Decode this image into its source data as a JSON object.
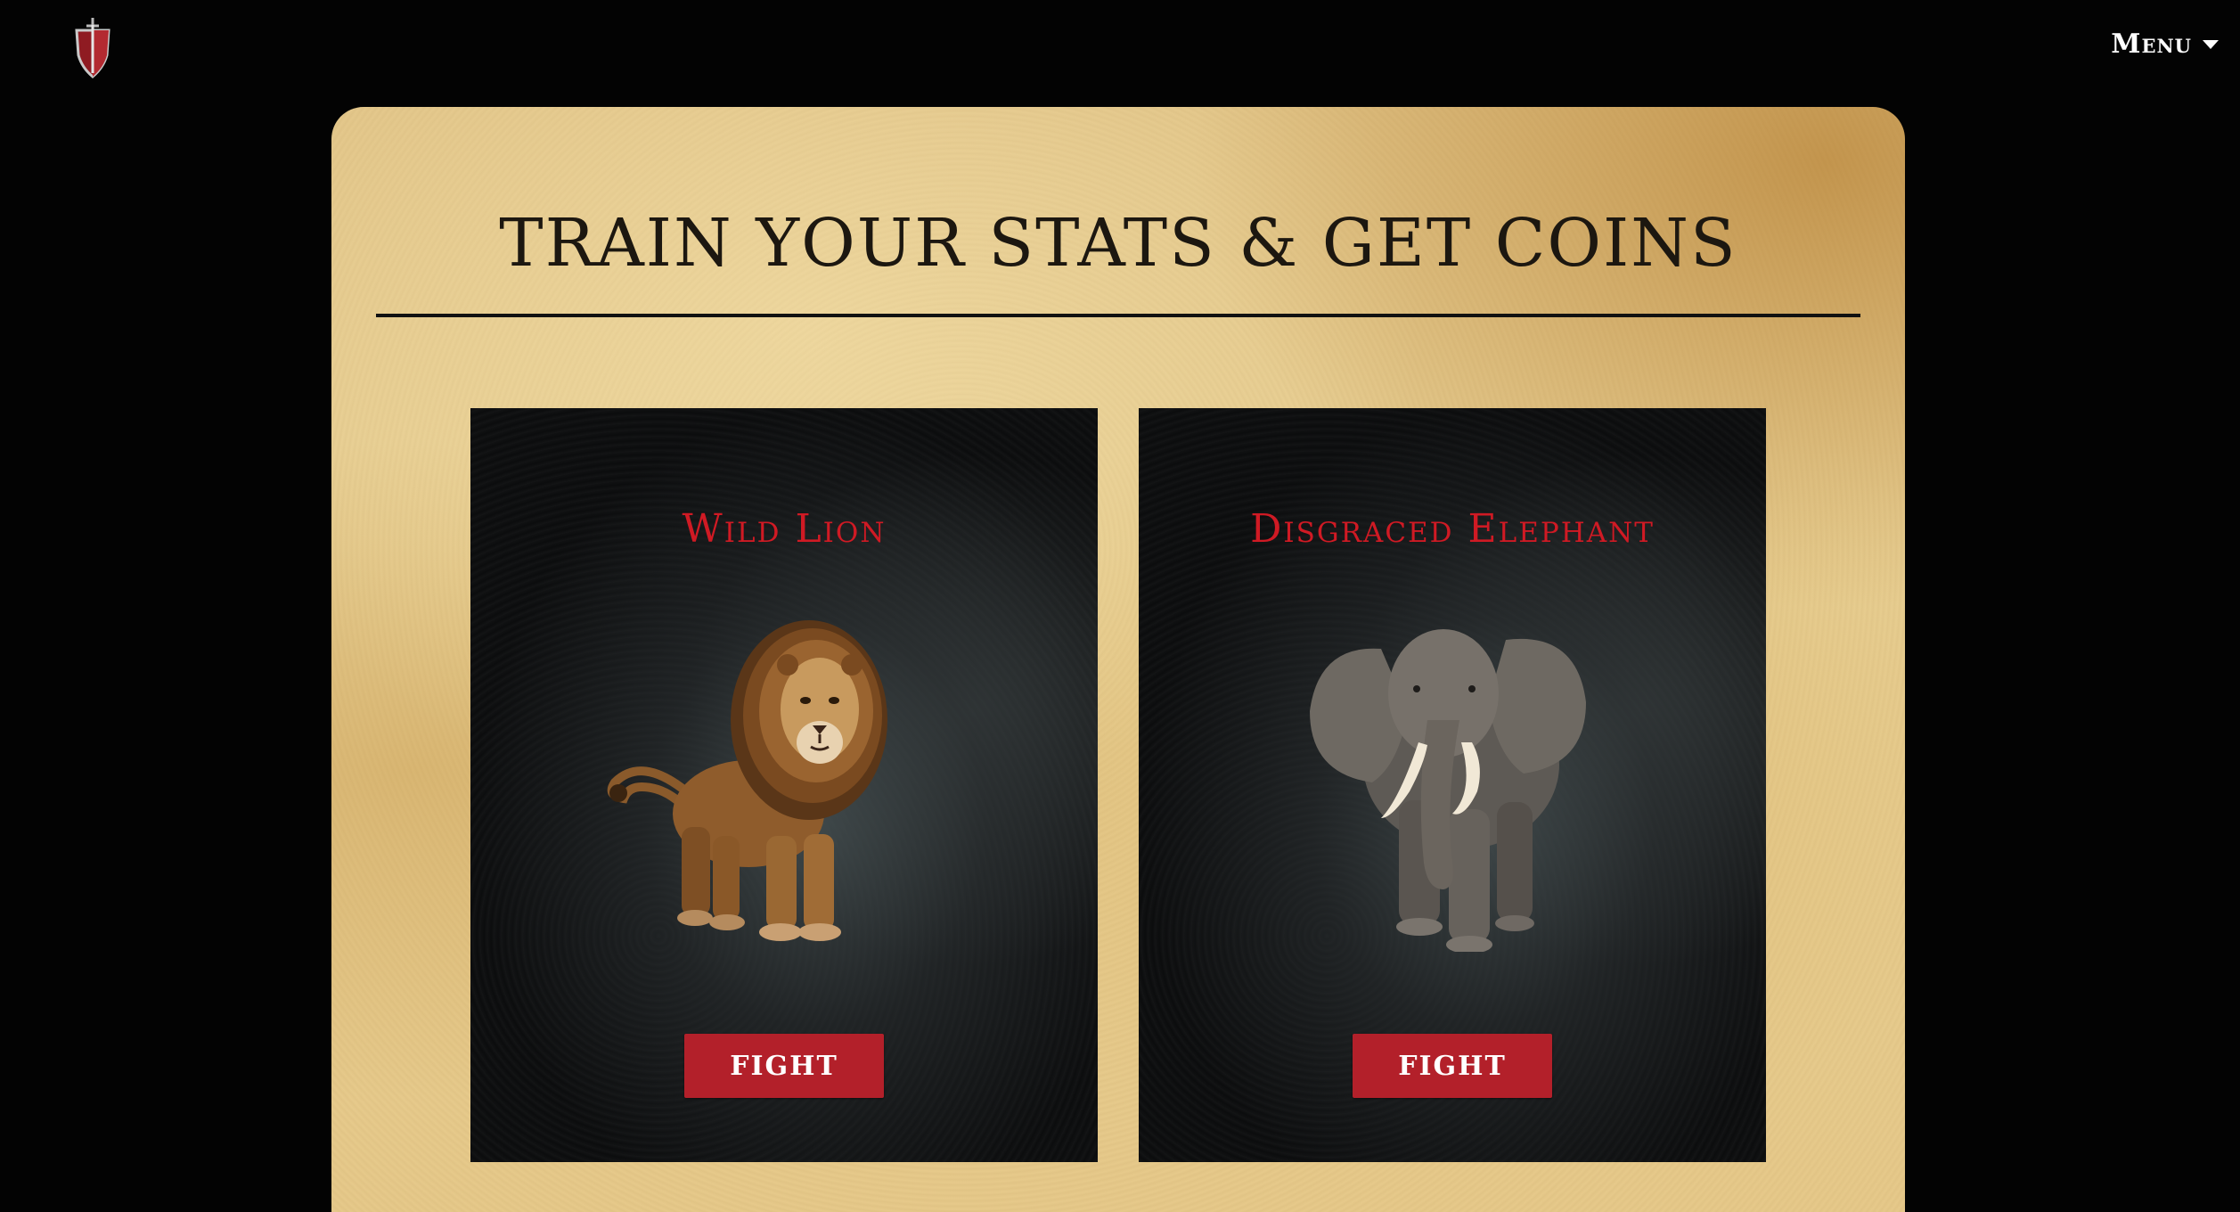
{
  "header": {
    "logo_icon": "shield-sword-icon",
    "menu_label": "Menu",
    "menu_icon": "caret-down-icon"
  },
  "main": {
    "title": "TRAIN YOUR STATS & GET COINS",
    "cards": [
      {
        "name": "Wild Lion",
        "image_icon": "lion-icon",
        "button_label": "FIGHT"
      },
      {
        "name": "Disgraced Elephant",
        "image_icon": "elephant-icon",
        "button_label": "FIGHT"
      }
    ]
  },
  "colors": {
    "page_background": "#030303",
    "card_title": "#d01a24",
    "fight_button": "#b3202a",
    "title_text": "#1c1710"
  }
}
